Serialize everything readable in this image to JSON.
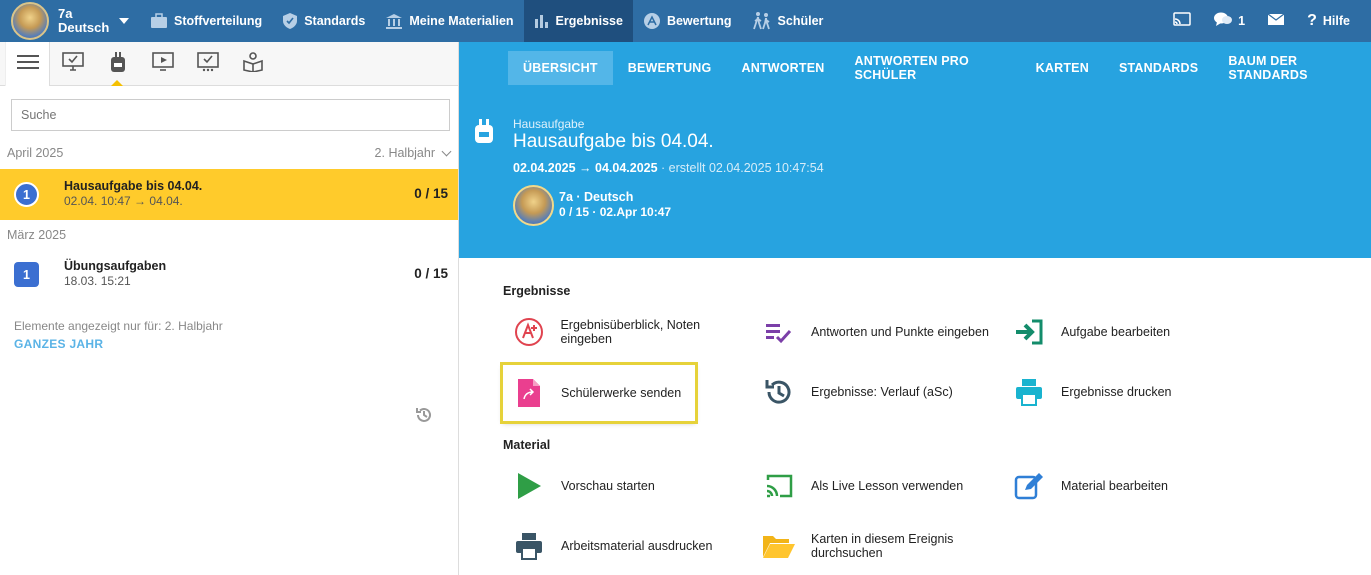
{
  "topbar": {
    "class_line1": "7a",
    "class_line2": "Deutsch",
    "nav": [
      {
        "label": "Stoffverteilung",
        "icon": "briefcase-icon"
      },
      {
        "label": "Standards",
        "icon": "shield-check-icon"
      },
      {
        "label": "Meine Materialien",
        "icon": "library-icon"
      },
      {
        "label": "Ergebnisse",
        "icon": "bar-chart-icon"
      },
      {
        "label": "Bewertung",
        "icon": "grade-icon"
      },
      {
        "label": "Schüler",
        "icon": "students-icon"
      }
    ],
    "messages_count": "1",
    "help_label": "Hilfe"
  },
  "left": {
    "search_placeholder": "Suche",
    "groups": [
      {
        "month": "April 2025"
      },
      {
        "month": "März 2025"
      }
    ],
    "halbjahr": "2. Halbjahr",
    "items": [
      {
        "badge": "1",
        "title": "Hausaufgabe bis 04.04.",
        "subtitle": "02.04. 10:47 → 04.04.",
        "count": "0 / 15"
      },
      {
        "badge": "1",
        "title": "Übungsaufgaben",
        "subtitle": "18.03. 15:21",
        "count": "0 / 15"
      }
    ],
    "note": "Elemente angezeigt nur für: 2. Halbjahr",
    "year_link": "GANZES JAHR"
  },
  "right": {
    "tabs": [
      "ÜBERSICHT",
      "BEWERTUNG",
      "ANTWORTEN",
      "ANTWORTEN PRO SCHÜLER",
      "KARTEN",
      "STANDARDS",
      "BAUM DER STANDARDS"
    ],
    "hero": {
      "kind": "Hausaufgabe",
      "title": "Hausaufgabe bis 04.04.",
      "date_range": "02.04.2025 → 04.04.2025",
      "created": " · erstellt 02.04.2025 10:47:54",
      "class_name": "7a · Deutsch",
      "class_stat": "0 / 15 · 02.Apr 10:47"
    },
    "sections": {
      "results": "Ergebnisse",
      "material": "Material"
    },
    "actions": {
      "overview": "Ergebnisüberblick, Noten eingeben",
      "answers": "Antworten und Punkte eingeben",
      "edit_task": "Aufgabe bearbeiten",
      "send_works": "Schülerwerke senden",
      "history": "Ergebnisse: Verlauf (aSc)",
      "print_results": "Ergebnisse drucken",
      "preview": "Vorschau starten",
      "live_lesson": "Als Live Lesson verwenden",
      "edit_material": "Material bearbeiten",
      "print_material": "Arbeitsmaterial ausdrucken",
      "browse_cards": "Karten in diesem Ereignis durchsuchen"
    }
  },
  "colors": {
    "topbar": "#2e6da4",
    "accent_blue": "#27a3e0",
    "active_row": "#ffcb2b",
    "highlight": "#e6d23a"
  }
}
